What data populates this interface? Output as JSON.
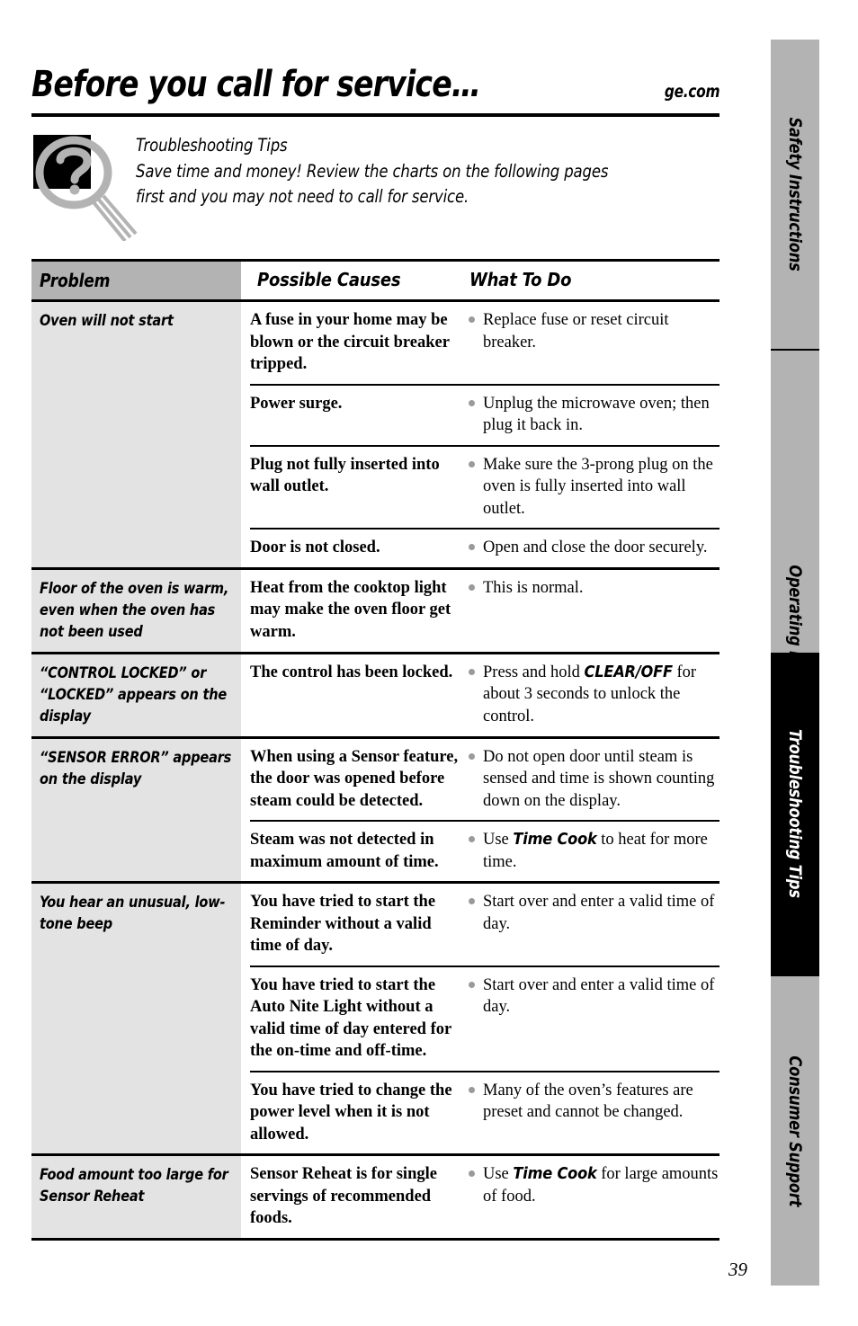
{
  "header": {
    "title": "Before you call for service…",
    "site": "ge.com"
  },
  "intro": {
    "icon": "question-magnifier-icon",
    "heading": "Troubleshooting Tips",
    "line2": "Save time and money! Review the charts on the following pages",
    "line3": "first and you may not need to call for service."
  },
  "table": {
    "columns": [
      "Problem",
      "Possible Causes",
      "What To Do"
    ],
    "groups": [
      {
        "problem": "Oven will not start",
        "rows": [
          {
            "cause": "A fuse in your home may be blown or the circuit breaker tripped.",
            "do_pre": "Replace fuse or reset circuit breaker.",
            "do_kbd": "",
            "do_post": ""
          },
          {
            "cause": "Power surge.",
            "do_pre": "Unplug the microwave oven; then plug it back in.",
            "do_kbd": "",
            "do_post": ""
          },
          {
            "cause": "Plug not fully inserted into wall outlet.",
            "do_pre": "Make sure the 3-prong plug on the oven is fully inserted into wall outlet.",
            "do_kbd": "",
            "do_post": ""
          },
          {
            "cause": "Door is not closed.",
            "do_pre": "Open and close the door securely.",
            "do_kbd": "",
            "do_post": ""
          }
        ]
      },
      {
        "problem": "Floor of the oven is warm, even when the oven has not been used",
        "rows": [
          {
            "cause": "Heat from the cooktop light may make the oven floor get warm.",
            "do_pre": "This is normal.",
            "do_kbd": "",
            "do_post": ""
          }
        ]
      },
      {
        "problem": "“CONTROL LOCKED” or “LOCKED” appears on the display",
        "rows": [
          {
            "cause": "The control has been locked.",
            "do_pre": "Press and hold ",
            "do_kbd": "CLEAR/OFF",
            "do_post": " for about 3 seconds to unlock the control."
          }
        ]
      },
      {
        "problem": "“SENSOR ERROR” appears on the display",
        "rows": [
          {
            "cause": "When using a Sensor feature, the door was opened before steam could be detected.",
            "do_pre": "Do not open door until steam is sensed and time is shown counting down on the display.",
            "do_kbd": "",
            "do_post": ""
          },
          {
            "cause": "Steam was not detected in maximum amount of time.",
            "do_pre": "Use ",
            "do_kbd": "Time Cook",
            "do_post": " to heat for more time."
          }
        ]
      },
      {
        "problem": "You hear an unusual, low-tone beep",
        "rows": [
          {
            "cause": "You have tried to start the Reminder without a valid time of day.",
            "do_pre": "Start over and enter a valid time of day.",
            "do_kbd": "",
            "do_post": ""
          },
          {
            "cause": "You have tried to start the Auto Nite Light without a valid time of day entered for the on-time and off-time.",
            "do_pre": "Start over and enter a valid time of day.",
            "do_kbd": "",
            "do_post": ""
          },
          {
            "cause": "You have tried to change the power level when it is not allowed.",
            "do_pre": "Many of the oven’s features are preset and cannot be changed.",
            "do_kbd": "",
            "do_post": ""
          }
        ]
      },
      {
        "problem": "Food amount too large for Sensor Reheat",
        "rows": [
          {
            "cause": "Sensor Reheat is for single servings of recommended foods.",
            "do_pre": "Use ",
            "do_kbd": "Time Cook",
            "do_post": " for large amounts of food."
          }
        ]
      }
    ]
  },
  "sidebar": {
    "tabs": [
      {
        "label": "Safety Instructions",
        "active": false
      },
      {
        "label": "Operating Instructions",
        "active": false
      },
      {
        "label": "Troubleshooting Tips",
        "active": true
      },
      {
        "label": "Consumer Support",
        "active": false
      }
    ],
    "active_color": "#000000",
    "inactive_color": "#b3b3b3"
  },
  "footer": {
    "page_number": "39"
  }
}
